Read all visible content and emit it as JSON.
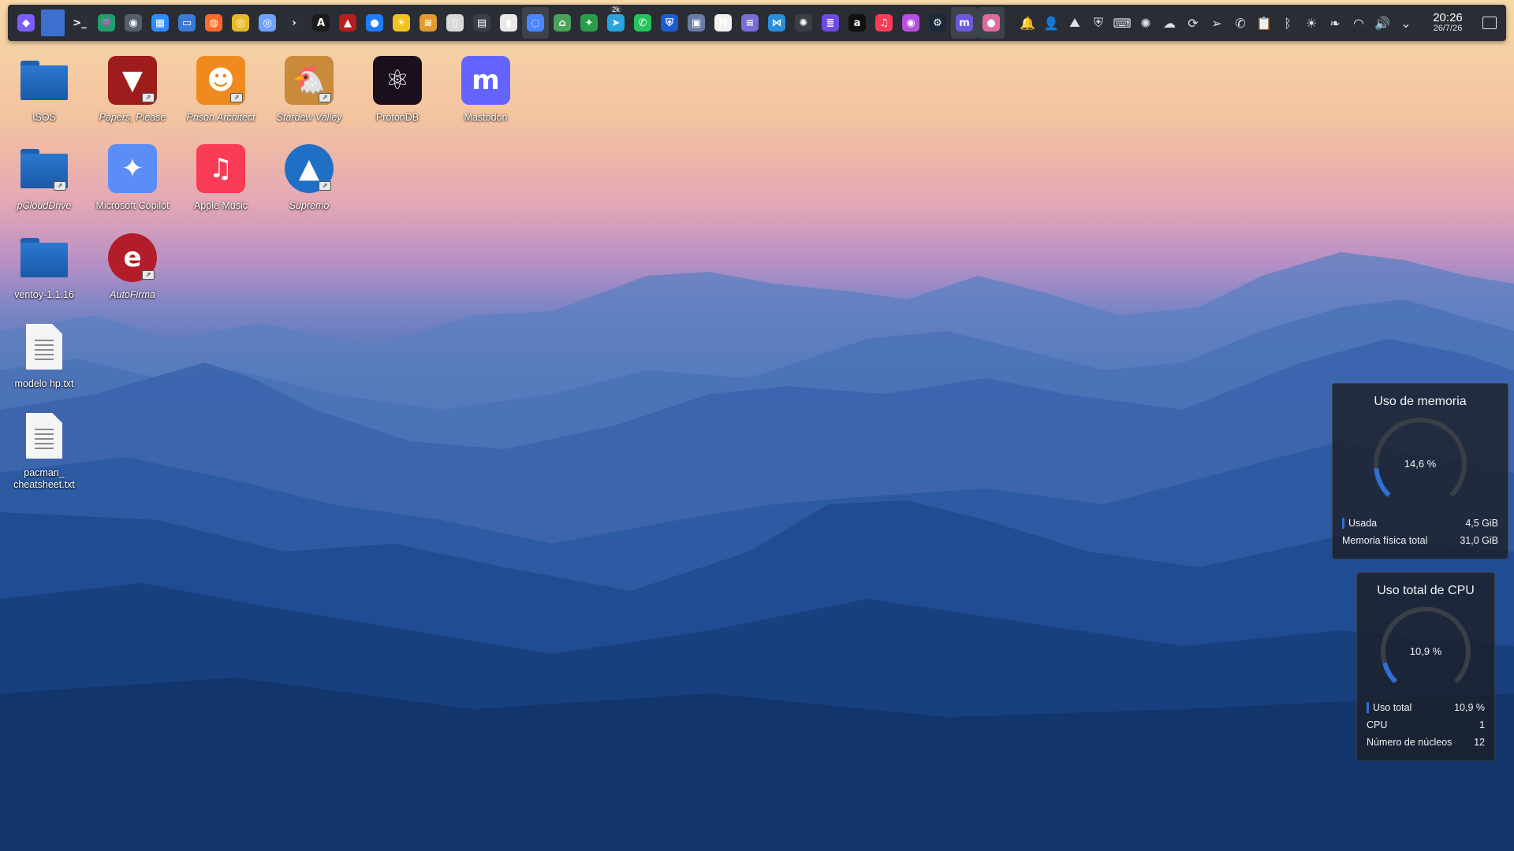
{
  "taskbar": {
    "apps": [
      {
        "icon": "kde-launcher-icon",
        "glyph": "◆",
        "color": "#7b5cff",
        "badge": ""
      },
      {
        "icon": "pager-desktop-icon",
        "glyph": "",
        "color": "#3b6fd0",
        "badge": ""
      },
      {
        "icon": "terminal-icon",
        "glyph": ">_",
        "color": "#2b3036",
        "badge": ""
      },
      {
        "icon": "ghost-game-icon",
        "glyph": "👾",
        "color": "#1f9f6a",
        "badge": ""
      },
      {
        "icon": "app-icon",
        "glyph": "◉",
        "color": "#555e6a",
        "badge": ""
      },
      {
        "icon": "calendar-icon",
        "glyph": "▦",
        "color": "#2d8cff",
        "badge": ""
      },
      {
        "icon": "file-manager-icon",
        "glyph": "▭",
        "color": "#3a7bd5",
        "badge": ""
      },
      {
        "icon": "firefox-icon",
        "glyph": "◍",
        "color": "#ff6a2a",
        "badge": ""
      },
      {
        "icon": "chrome-icon",
        "glyph": "◎",
        "color": "#e8b92a",
        "badge": ""
      },
      {
        "icon": "chromium-icon",
        "glyph": "◎",
        "color": "#6fa2ff",
        "badge": ""
      },
      {
        "icon": "konsole-icon",
        "glyph": "›",
        "color": "#2b3036",
        "badge": ""
      },
      {
        "icon": "text-editor-icon",
        "glyph": "A",
        "color": "#1c1c1c",
        "badge": ""
      },
      {
        "icon": "papers-please-icon",
        "glyph": "▲",
        "color": "#b51f1f",
        "badge": ""
      },
      {
        "icon": "browser-icon",
        "glyph": "●",
        "color": "#1f7bff",
        "badge": ""
      },
      {
        "icon": "weather-icon",
        "glyph": "☀",
        "color": "#f0c420",
        "badge": ""
      },
      {
        "icon": "layers-icon",
        "glyph": "≋",
        "color": "#e29a2e",
        "badge": ""
      },
      {
        "icon": "document-icon",
        "glyph": "▯",
        "color": "#d9d9d9",
        "badge": ""
      },
      {
        "icon": "calculator-icon",
        "glyph": "▤",
        "color": "#3a3f46",
        "badge": ""
      },
      {
        "icon": "notes-icon",
        "glyph": "▮",
        "color": "#e9e9e9",
        "badge": ""
      },
      {
        "icon": "app-active-icon",
        "glyph": "◌",
        "color": "#4a86ff",
        "badge": ""
      },
      {
        "icon": "drive-icon",
        "glyph": "⌂",
        "color": "#4aa35a",
        "badge": ""
      },
      {
        "icon": "maps-icon",
        "glyph": "✦",
        "color": "#2a9d4a",
        "badge": ""
      },
      {
        "icon": "telegram-icon",
        "glyph": "➤",
        "color": "#2aa3e0",
        "badge": "2k"
      },
      {
        "icon": "whatsapp-icon",
        "glyph": "✆",
        "color": "#24c45a",
        "badge": ""
      },
      {
        "icon": "bitwarden-icon",
        "glyph": "⛨",
        "color": "#1c5bd1",
        "badge": ""
      },
      {
        "icon": "remote-desktop-icon",
        "glyph": "▣",
        "color": "#6c7aa8",
        "badge": ""
      },
      {
        "icon": "notion-icon",
        "glyph": "N",
        "color": "#f2f2f2",
        "badge": ""
      },
      {
        "icon": "app-list-icon",
        "glyph": "≡",
        "color": "#7a6bd6",
        "badge": ""
      },
      {
        "icon": "vscode-icon",
        "glyph": "⋈",
        "color": "#2a8edb",
        "badge": ""
      },
      {
        "icon": "chatgpt-icon",
        "glyph": "✺",
        "color": "#3a3f46",
        "badge": ""
      },
      {
        "icon": "editor-icon",
        "glyph": "≣",
        "color": "#6d4ae0",
        "badge": ""
      },
      {
        "icon": "amazon-icon",
        "glyph": "a",
        "color": "#111111",
        "badge": ""
      },
      {
        "icon": "apple-music-icon",
        "glyph": "♫",
        "color": "#fa3b55",
        "badge": ""
      },
      {
        "icon": "podcasts-icon",
        "glyph": "◉",
        "color": "#b44fe0",
        "badge": ""
      },
      {
        "icon": "steam-icon",
        "glyph": "⚙",
        "color": "#1b2838",
        "badge": ""
      },
      {
        "icon": "mastodon-icon",
        "glyph": "m",
        "color": "#6d59e0",
        "badge": ""
      },
      {
        "icon": "app-pink-icon",
        "glyph": "●",
        "color": "#e06aa0",
        "badge": ""
      }
    ],
    "active_indices": [
      19,
      35,
      36
    ],
    "tray": [
      {
        "icon": "notifications-icon",
        "glyph": "🔔"
      },
      {
        "icon": "user-icon",
        "glyph": "👤"
      },
      {
        "icon": "network-drive-icon",
        "glyph": "⛰"
      },
      {
        "icon": "bitwarden-tray-icon",
        "glyph": "⛨"
      },
      {
        "icon": "keyboard-icon",
        "glyph": "⌨"
      },
      {
        "icon": "settings-sun-icon",
        "glyph": "✺"
      },
      {
        "icon": "cloud-icon",
        "glyph": "☁"
      },
      {
        "icon": "sync-icon",
        "glyph": "⟳"
      },
      {
        "icon": "send-icon",
        "glyph": "➢"
      },
      {
        "icon": "whatsapp-tray-icon",
        "glyph": "✆"
      },
      {
        "icon": "clipboard-icon",
        "glyph": "📋"
      },
      {
        "icon": "bluetooth-icon",
        "glyph": "ᛒ"
      },
      {
        "icon": "brightness-icon",
        "glyph": "☀"
      },
      {
        "icon": "leaf-icon",
        "glyph": "❧"
      },
      {
        "icon": "wifi-icon",
        "glyph": "◠"
      },
      {
        "icon": "volume-icon",
        "glyph": "🔊"
      },
      {
        "icon": "chevron-up-icon",
        "glyph": "⌄"
      }
    ],
    "clock": {
      "time": "20:26",
      "date": "26/7/26"
    }
  },
  "desktop": {
    "icons": [
      {
        "label": "ISOS",
        "kind": "folder",
        "italic": false,
        "link": false
      },
      {
        "label": "Papers, Please",
        "kind": "app",
        "italic": true,
        "link": true,
        "color": "#9e1c1c",
        "glyph": "▼"
      },
      {
        "label": "Prison Architect",
        "kind": "app",
        "italic": true,
        "link": true,
        "color": "#f08a1e",
        "glyph": "☻"
      },
      {
        "label": "Stardew Valley",
        "kind": "app",
        "italic": true,
        "link": true,
        "color": "#c98a3a",
        "glyph": "🐔"
      },
      {
        "label": "ProtonDB",
        "kind": "app",
        "italic": false,
        "link": false,
        "color": "#1a0f1c",
        "glyph": "⚛"
      },
      {
        "label": "Mastodon",
        "kind": "app",
        "italic": false,
        "link": false,
        "color": "#6364ff",
        "glyph": "m"
      },
      {
        "label": "pCloudDrive",
        "kind": "folder",
        "italic": true,
        "link": true
      },
      {
        "label": "Microsoft Copilot",
        "kind": "app",
        "italic": false,
        "link": false,
        "color": "#5a8df5",
        "glyph": "✦"
      },
      {
        "label": "Apple Music",
        "kind": "app",
        "italic": false,
        "link": false,
        "color": "#fa3b55",
        "glyph": "♫"
      },
      {
        "label": "Supremo",
        "kind": "app",
        "italic": true,
        "link": true,
        "color": "#1f6fc7",
        "glyph": "▲"
      },
      {
        "label": "ventoy-1.1.16",
        "kind": "folder",
        "italic": false,
        "link": false
      },
      {
        "label": "AutoFirma",
        "kind": "app",
        "italic": true,
        "link": true,
        "color": "#b31d2a",
        "glyph": "e"
      },
      {
        "label": "modelo hp.txt",
        "kind": "text",
        "italic": false,
        "link": false
      },
      {
        "label": "pacman_\ncheatsheet.txt",
        "kind": "text",
        "italic": false,
        "link": false
      }
    ]
  },
  "widgets": {
    "memory": {
      "title": "Uso de memoria",
      "value_text": "14,6 %",
      "fraction": 0.146,
      "rows": [
        {
          "label": "Usada",
          "value": "4,5 GiB",
          "swatch": true
        },
        {
          "label": "Memoria física total",
          "value": "31,0 GiB",
          "swatch": false
        }
      ]
    },
    "cpu": {
      "title": "Uso total de CPU",
      "value_text": "10,9 %",
      "fraction": 0.109,
      "rows": [
        {
          "label": "Uso total",
          "value": "10,9 %",
          "swatch": true
        },
        {
          "label": "CPU",
          "value": "1",
          "swatch": false
        },
        {
          "label": "Número de núcleos",
          "value": "12",
          "swatch": false
        }
      ]
    },
    "accent": "#2f6fd6"
  }
}
